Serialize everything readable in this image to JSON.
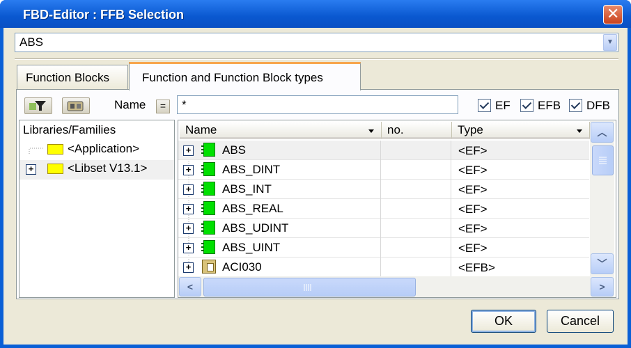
{
  "window": {
    "title": "FBD-Editor : FFB Selection",
    "close_glyph": "✕"
  },
  "selector": {
    "value": "ABS",
    "arrow_glyph": "▼"
  },
  "tabs": [
    {
      "label": "Function Blocks"
    },
    {
      "label": "Function and Function Block types"
    }
  ],
  "toolbar": {
    "name_label": "Name",
    "eq_label": "=",
    "filter_value": "*"
  },
  "checkboxes": [
    {
      "label": "EF",
      "checked": true
    },
    {
      "label": "EFB",
      "checked": true
    },
    {
      "label": "DFB",
      "checked": true
    }
  ],
  "tree": {
    "header": "Libraries/Families",
    "items": [
      {
        "label": "<Application>",
        "expandable": false
      },
      {
        "label": "<Libset V13.1>",
        "expandable": true,
        "selected": true
      }
    ]
  },
  "grid": {
    "columns": [
      {
        "label": "Name"
      },
      {
        "label": "no."
      },
      {
        "label": "Type"
      }
    ],
    "rows": [
      {
        "name": "ABS",
        "no": "",
        "type": "<EF>",
        "icon": "ef-block-icon"
      },
      {
        "name": "ABS_DINT",
        "no": "",
        "type": "<EF>",
        "icon": "ef-block-icon"
      },
      {
        "name": "ABS_INT",
        "no": "",
        "type": "<EF>",
        "icon": "ef-block-icon"
      },
      {
        "name": "ABS_REAL",
        "no": "",
        "type": "<EF>",
        "icon": "ef-block-icon"
      },
      {
        "name": "ABS_UDINT",
        "no": "",
        "type": "<EF>",
        "icon": "ef-block-icon"
      },
      {
        "name": "ABS_UINT",
        "no": "",
        "type": "<EF>",
        "icon": "ef-block-icon"
      },
      {
        "name": "ACI030",
        "no": "",
        "type": "<EFB>",
        "icon": "efb-block-icon"
      }
    ]
  },
  "buttons": {
    "ok": "OK",
    "cancel": "Cancel"
  },
  "colors": {
    "titlebar": "#0a58d0",
    "tab_accent": "#f7a64e",
    "ef_icon": "#00e000"
  }
}
